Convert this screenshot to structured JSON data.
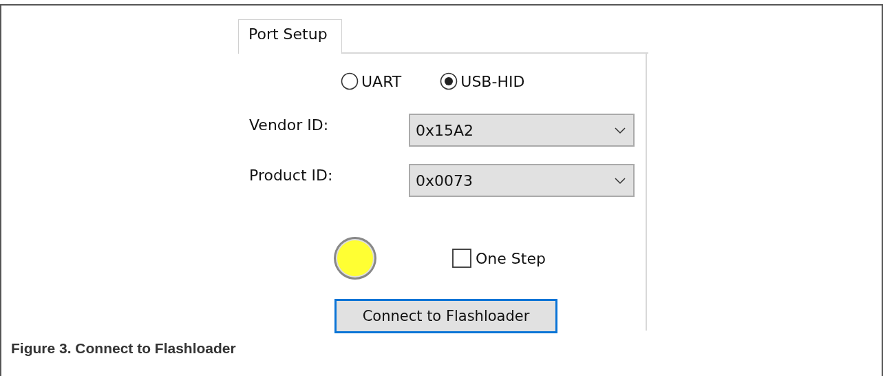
{
  "tabs": [
    {
      "label": "Port Setup",
      "selected": true
    }
  ],
  "interface": [
    {
      "label": "UART",
      "selected": false
    },
    {
      "label": "USB-HID",
      "selected": true
    }
  ],
  "fields": [
    {
      "label": "Vendor ID:",
      "value": "0x15A2"
    },
    {
      "label": "Product ID:",
      "value": "0x0073"
    }
  ],
  "status_indicator": {
    "color": "#ffff33"
  },
  "one_step": {
    "label": "One Step",
    "checked": false
  },
  "connect_button": {
    "label": "Connect to Flashloader",
    "focused": true
  },
  "caption": "Figure 3.  Connect to Flashloader"
}
